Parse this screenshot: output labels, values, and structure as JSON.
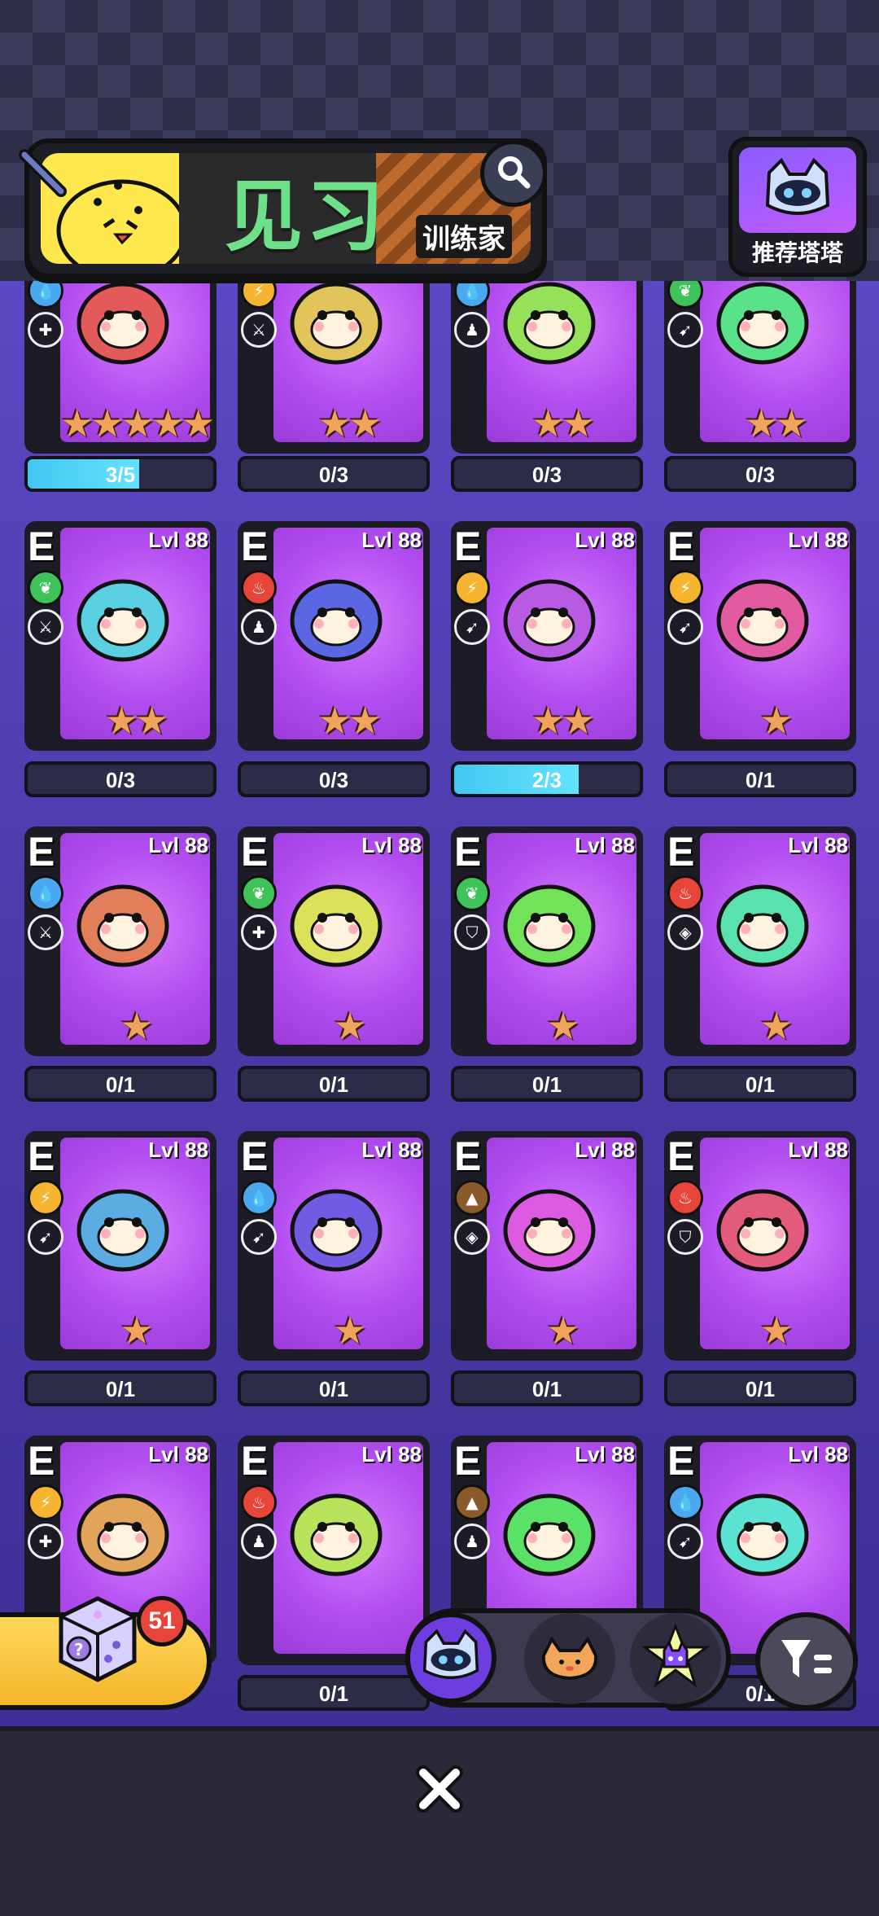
{
  "header": {
    "title": "见习",
    "subtitle": "训练家",
    "recommend_label": "推荐塔塔"
  },
  "cards": [
    {
      "rank": "",
      "level": "",
      "element": "water",
      "role": "heal",
      "stars": "★★★★★",
      "progress": "3/5",
      "progress_value": 0.6,
      "creature": "blue-walrus"
    },
    {
      "rank": "",
      "level": "",
      "element": "electric",
      "role": "attack",
      "stars": "★★",
      "progress": "0/3",
      "progress_value": 0,
      "creature": "yellow-dog"
    },
    {
      "rank": "",
      "level": "",
      "element": "water",
      "role": "support",
      "stars": "★★",
      "progress": "0/3",
      "progress_value": 0,
      "creature": "crab"
    },
    {
      "rank": "",
      "level": "",
      "element": "grass",
      "role": "speed",
      "stars": "★★",
      "progress": "0/3",
      "progress_value": 0,
      "creature": "cactus"
    },
    {
      "rank": "E",
      "level": "Lvl 88",
      "element": "grass",
      "role": "attack",
      "stars": "★★",
      "progress": "0/3",
      "progress_value": 0,
      "creature": "mushroom"
    },
    {
      "rank": "E",
      "level": "Lvl 88",
      "element": "fire",
      "role": "support",
      "stars": "★★",
      "progress": "0/3",
      "progress_value": 0,
      "creature": "fire-bird"
    },
    {
      "rank": "E",
      "level": "Lvl 88",
      "element": "electric",
      "role": "speed",
      "stars": "★★",
      "progress": "2/3",
      "progress_value": 0.67,
      "creature": "lion-monkey"
    },
    {
      "rank": "E",
      "level": "Lvl 88",
      "element": "electric",
      "role": "speed",
      "stars": "★",
      "progress": "0/1",
      "progress_value": 0,
      "creature": "deer"
    },
    {
      "rank": "E",
      "level": "Lvl 88",
      "element": "water",
      "role": "attack",
      "stars": "★",
      "progress": "0/1",
      "progress_value": 0,
      "creature": "snow-bunny"
    },
    {
      "rank": "E",
      "level": "Lvl 88",
      "element": "grass",
      "role": "heal",
      "stars": "★",
      "progress": "0/1",
      "progress_value": 0,
      "creature": "sunflower"
    },
    {
      "rank": "E",
      "level": "Lvl 88",
      "element": "grass",
      "role": "defense",
      "stars": "★",
      "progress": "0/1",
      "progress_value": 0,
      "creature": "jelly-frog"
    },
    {
      "rank": "E",
      "level": "Lvl 88",
      "element": "fire",
      "role": "target",
      "stars": "★",
      "progress": "0/1",
      "progress_value": 0,
      "creature": "tiger"
    },
    {
      "rank": "E",
      "level": "Lvl 88",
      "element": "electric",
      "role": "speed",
      "stars": "★",
      "progress": "0/1",
      "progress_value": 0,
      "creature": "cloud-sheep"
    },
    {
      "rank": "E",
      "level": "Lvl 88",
      "element": "water",
      "role": "speed",
      "stars": "★",
      "progress": "0/1",
      "progress_value": 0,
      "creature": "octopus"
    },
    {
      "rank": "E",
      "level": "Lvl 88",
      "element": "earth",
      "role": "target",
      "stars": "★",
      "progress": "0/1",
      "progress_value": 0,
      "creature": "boar"
    },
    {
      "rank": "E",
      "level": "Lvl 88",
      "element": "fire",
      "role": "defense",
      "stars": "★",
      "progress": "0/1",
      "progress_value": 0,
      "creature": "penguin"
    },
    {
      "rank": "E",
      "level": "Lvl 88",
      "element": "electric",
      "role": "heal",
      "stars": "",
      "progress": "",
      "progress_value": 0,
      "creature": "coin-beetle"
    },
    {
      "rank": "E",
      "level": "Lvl 88",
      "element": "fire",
      "role": "support",
      "stars": "",
      "progress": "0/1",
      "progress_value": 0,
      "creature": "shiba"
    },
    {
      "rank": "E",
      "level": "Lvl 88",
      "element": "earth",
      "role": "support",
      "stars": "",
      "progress": "",
      "progress_value": 0,
      "creature": "otter"
    },
    {
      "rank": "E",
      "level": "Lvl 88",
      "element": "water",
      "role": "speed",
      "stars": "",
      "progress": "0/1",
      "progress_value": 0,
      "creature": "fish-pumpkin"
    }
  ],
  "dice_count": "51",
  "tabs": [
    {
      "name": "robot-cat",
      "active": true
    },
    {
      "name": "bread-cat",
      "active": false
    },
    {
      "name": "star-cat",
      "active": false
    }
  ],
  "colors": {
    "grass": "#3fc25a",
    "fire": "#e8453a",
    "electric": "#f6b531",
    "water": "#4aa8f0",
    "earth": "#8a5a2a"
  }
}
